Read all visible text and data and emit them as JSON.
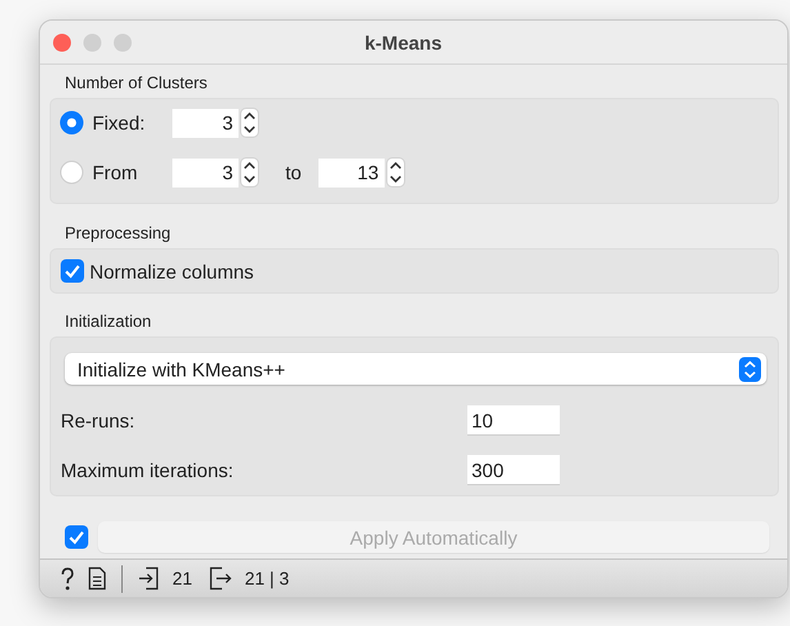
{
  "window": {
    "title": "k-Means"
  },
  "clusters": {
    "title": "Number of Clusters",
    "options": [
      {
        "label": "Fixed:",
        "selected": true,
        "value": "3"
      },
      {
        "label": "From",
        "selected": false,
        "value": "3",
        "to_label": "to",
        "to_value": "13"
      }
    ]
  },
  "preprocessing": {
    "title": "Preprocessing",
    "checkbox": {
      "label": "Normalize columns",
      "checked": true
    }
  },
  "initialization": {
    "title": "Initialization",
    "method": "Initialize with KMeans++",
    "fields": [
      {
        "label": "Re-runs:",
        "value": "10"
      },
      {
        "label": "Maximum iterations:",
        "value": "300"
      }
    ]
  },
  "apply": {
    "auto": true,
    "label": "Apply Automatically",
    "disabled": true
  },
  "status_bar": {
    "input_count": "21",
    "output_count": "21 | 3"
  }
}
